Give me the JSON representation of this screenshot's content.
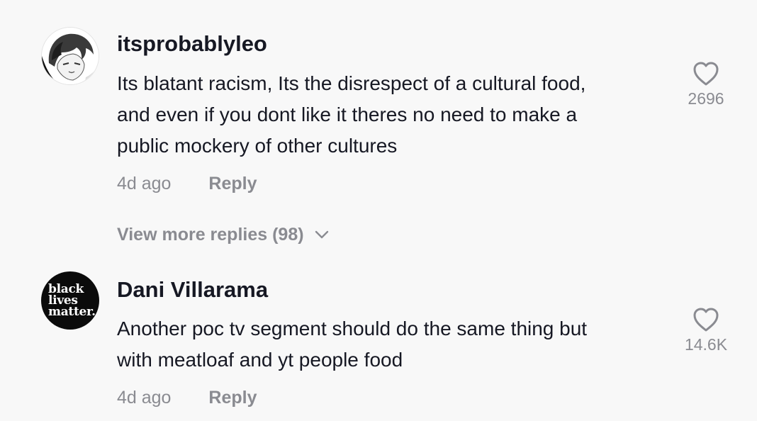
{
  "comments": [
    {
      "username": "itsprobablyleo",
      "text_lines": [
        "Its blatant racism, Its the disrespect of a cultural food,",
        "and even if you dont like it theres no need to make a",
        "public mockery of other cultures"
      ],
      "time": "4d ago",
      "reply_label": "Reply",
      "like_count": "2696",
      "avatar_icon": "anime-portrait-avatar"
    },
    {
      "username": "Dani Villarama",
      "text_lines": [
        "Another poc tv segment should do the same thing but",
        "with meatloaf and yt people food"
      ],
      "time": "4d ago",
      "reply_label": "Reply",
      "like_count": "14.6K",
      "avatar_lines": [
        "black",
        "lives",
        "matter."
      ]
    }
  ],
  "view_more_replies": "View more replies (98)",
  "colors": {
    "background": "#f8f8f8",
    "primary_text": "#161823",
    "secondary_text": "#8a8b91"
  }
}
